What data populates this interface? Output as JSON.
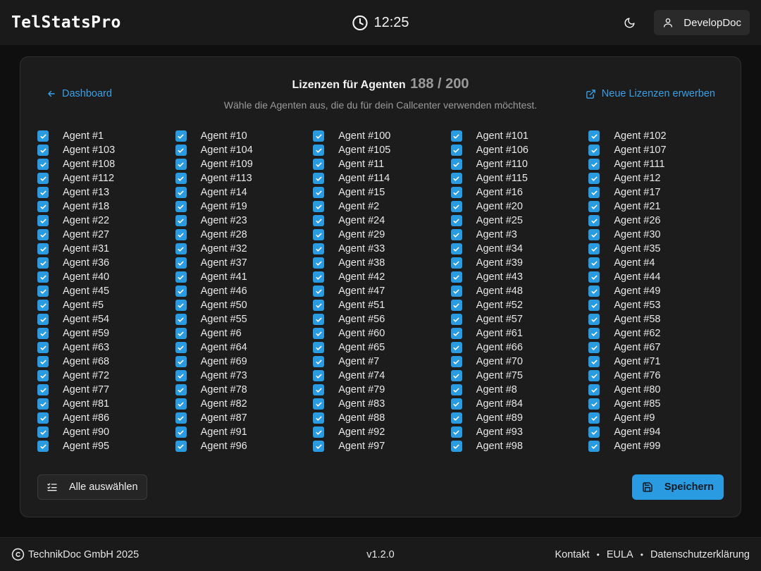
{
  "header": {
    "logo": "TelStatsPro",
    "time": "12:25",
    "user_name": "DevelopDoc"
  },
  "page": {
    "back_label": "Dashboard",
    "title": "Lizenzen für Agenten",
    "count": "188 / 200",
    "subtitle": "Wähle die Agenten aus, die du für dein Callcenter verwenden möchtest.",
    "buy_label": "Neue Lizenzen erwerben",
    "select_all_label": "Alle auswählen",
    "save_label": "Speichern"
  },
  "agents": [
    "Agent #1",
    "Agent #10",
    "Agent #100",
    "Agent #101",
    "Agent #102",
    "Agent #103",
    "Agent #104",
    "Agent #105",
    "Agent #106",
    "Agent #107",
    "Agent #108",
    "Agent #109",
    "Agent #11",
    "Agent #110",
    "Agent #111",
    "Agent #112",
    "Agent #113",
    "Agent #114",
    "Agent #115",
    "Agent #12",
    "Agent #13",
    "Agent #14",
    "Agent #15",
    "Agent #16",
    "Agent #17",
    "Agent #18",
    "Agent #19",
    "Agent #2",
    "Agent #20",
    "Agent #21",
    "Agent #22",
    "Agent #23",
    "Agent #24",
    "Agent #25",
    "Agent #26",
    "Agent #27",
    "Agent #28",
    "Agent #29",
    "Agent #3",
    "Agent #30",
    "Agent #31",
    "Agent #32",
    "Agent #33",
    "Agent #34",
    "Agent #35",
    "Agent #36",
    "Agent #37",
    "Agent #38",
    "Agent #39",
    "Agent #4",
    "Agent #40",
    "Agent #41",
    "Agent #42",
    "Agent #43",
    "Agent #44",
    "Agent #45",
    "Agent #46",
    "Agent #47",
    "Agent #48",
    "Agent #49",
    "Agent #5",
    "Agent #50",
    "Agent #51",
    "Agent #52",
    "Agent #53",
    "Agent #54",
    "Agent #55",
    "Agent #56",
    "Agent #57",
    "Agent #58",
    "Agent #59",
    "Agent #6",
    "Agent #60",
    "Agent #61",
    "Agent #62",
    "Agent #63",
    "Agent #64",
    "Agent #65",
    "Agent #66",
    "Agent #67",
    "Agent #68",
    "Agent #69",
    "Agent #7",
    "Agent #70",
    "Agent #71",
    "Agent #72",
    "Agent #73",
    "Agent #74",
    "Agent #75",
    "Agent #76",
    "Agent #77",
    "Agent #78",
    "Agent #79",
    "Agent #8",
    "Agent #80",
    "Agent #81",
    "Agent #82",
    "Agent #83",
    "Agent #84",
    "Agent #85",
    "Agent #86",
    "Agent #87",
    "Agent #88",
    "Agent #89",
    "Agent #9",
    "Agent #90",
    "Agent #91",
    "Agent #92",
    "Agent #93",
    "Agent #94",
    "Agent #95",
    "Agent #96",
    "Agent #97",
    "Agent #98",
    "Agent #99"
  ],
  "footer": {
    "copyright": "TechnikDoc GmbH 2025",
    "version": "v1.2.0",
    "links": [
      "Kontakt",
      "EULA",
      "Datenschutzerklärung"
    ]
  },
  "colors": {
    "accent": "#2a9be0",
    "link": "#3aa0e6",
    "background": "#0f0f0f",
    "card": "#1c1c1c"
  }
}
